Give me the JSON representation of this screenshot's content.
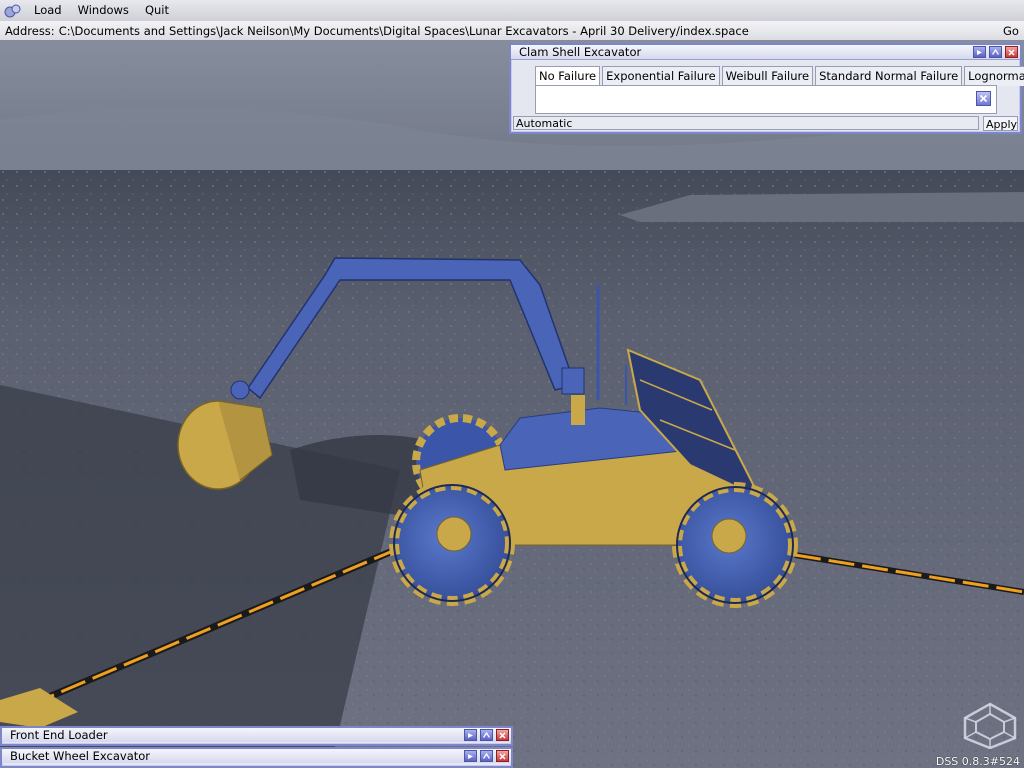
{
  "menu": {
    "items": [
      "Load",
      "Windows",
      "Quit"
    ]
  },
  "address": {
    "label": "Address:",
    "value": "C:\\Documents and Settings\\Jack Neilson\\My Documents\\Digital Spaces\\Lunar Excavators - April 30 Delivery/index.space",
    "go_label": "Go"
  },
  "clam_window": {
    "title": "Clam Shell Excavator",
    "tabs": [
      "No Failure",
      "Exponential Failure",
      "Weibull Failure",
      "Standard Normal Failure",
      "Lognormal"
    ],
    "active_tab": "No Failure",
    "mode_value": "Automatic",
    "apply_label": "Apply"
  },
  "front_end_loader_window": {
    "title": "Front End Loader"
  },
  "bucket_wheel_window": {
    "title": "Bucket Wheel Excavator"
  },
  "status": {
    "text": "DSS 0.8.3#524"
  },
  "colors": {
    "accent_border": "#7d86c8",
    "vehicle_blue": "#4a64b8",
    "vehicle_gold": "#c9a84a",
    "ground": "#5e6170",
    "cable": "#f0a020"
  },
  "icons": {
    "app": "app-logo-icon",
    "minimize": "minimize-icon",
    "maximize": "maximize-icon",
    "close": "close-icon",
    "dss_logo": "dss-hexagon-logo-icon"
  }
}
